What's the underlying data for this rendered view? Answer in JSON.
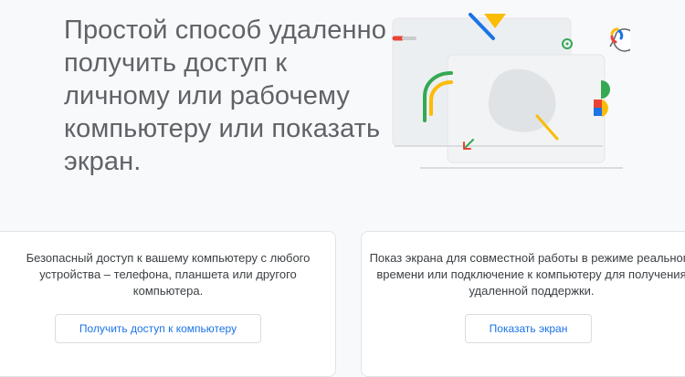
{
  "hero": {
    "title": "Простой способ удаленно получить доступ к личному или рабочему компьютеру или показать экран."
  },
  "cards": {
    "remote_access": {
      "description": "Безопасный доступ к вашему компьютеру с любого устройства – телефона, планшета или другого компьютера.",
      "button_label": "Получить доступ к компьютеру"
    },
    "remote_support": {
      "description": "Показ экрана для совместной работы в режиме реального времени или подключение к компьютеру для получения удаленной поддержки.",
      "button_label": "Показать экран"
    }
  },
  "colors": {
    "accent_blue": "#1a73e8",
    "google_red": "#ea4335",
    "google_yellow": "#fbbc04",
    "google_green": "#34a853",
    "text_gray": "#5f6368"
  }
}
